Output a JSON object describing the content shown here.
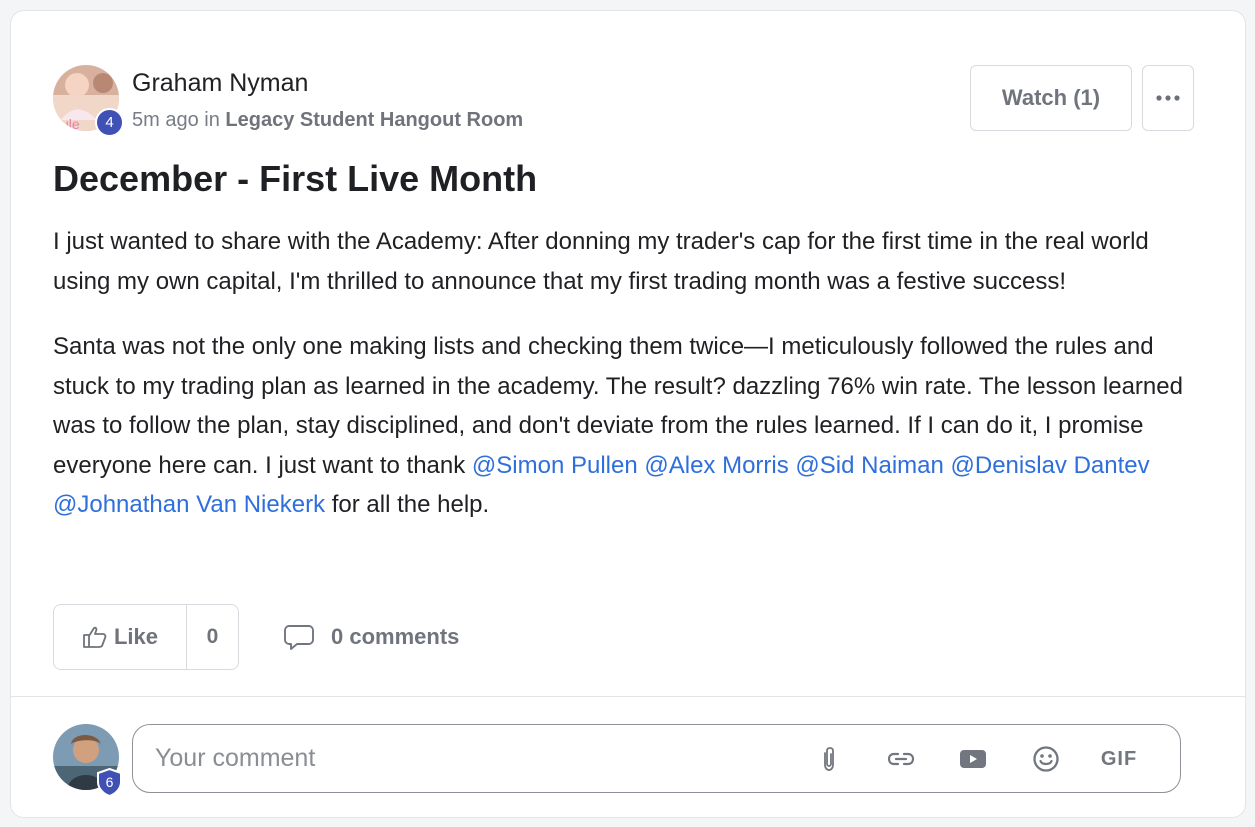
{
  "post": {
    "author": {
      "name": "Graham Nyman",
      "level": "4",
      "time": "5m ago",
      "in_text": "in",
      "room": "Legacy Student Hangout Room"
    },
    "watch_label": "Watch (1)",
    "title": "December - First Live Month",
    "paragraph1": "I just wanted to share with the Academy: After donning my trader's cap for the first time in the real world using my own capital, I'm thrilled to announce that my first trading month was a festive success!",
    "paragraph2_text": "Santa was not the only one making lists and checking them twice—I meticulously followed the rules and stuck to my trading plan as learned in the academy. The result? dazzling 76% win rate. The lesson learned was to follow the plan, stay disciplined, and don't deviate from the rules learned. If I can do it, I promise everyone here can. I just want to thank",
    "mentions": [
      "@Simon Pullen",
      "@Alex Morris",
      "@Sid Naiman",
      "@Denislav Dantev",
      "@Johnathan Van Niekerk"
    ],
    "paragraph2_end": "for all the help.",
    "like_label": "Like",
    "like_count": "0",
    "comments_label": "0 comments"
  },
  "composer": {
    "level": "6",
    "placeholder": "Your comment",
    "tools": [
      "paperclip-icon",
      "link-icon",
      "youtube-icon",
      "emoji-icon"
    ],
    "gif_label": "GIF"
  },
  "colors": {
    "mention": "#2f6fdc",
    "level_badge": "#3f51b5",
    "muted_text": "#70747c"
  }
}
